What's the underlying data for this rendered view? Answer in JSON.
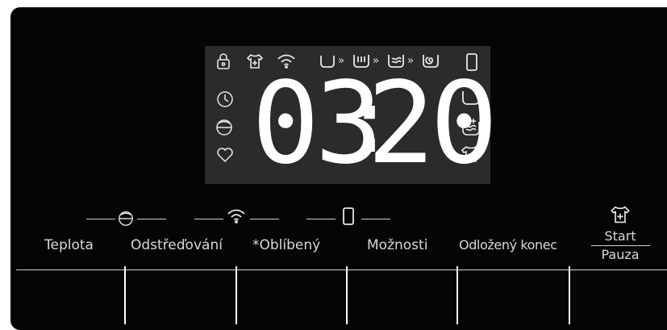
{
  "display": {
    "time_hours": "03",
    "time_minutes": "20",
    "colon": ":",
    "progress_chevron": "»"
  },
  "icons": {
    "top_row": [
      "lock-icon",
      "shirt-plus-icon",
      "wifi-icon",
      "tub-icon",
      "tub-wash-icon",
      "tub-rinse-icon",
      "tub-spin-icon",
      "phone-icon"
    ],
    "left_col": [
      "clock-icon",
      "spin-drum-icon",
      "heart-icon"
    ],
    "right_col": [
      "tub-icon",
      "tub-add-icon",
      "shirt-dry-icon"
    ]
  },
  "buttons": {
    "teplota": "Teplota",
    "odstredovani": "Odstřeďování",
    "oblibeny": "*Oblíbený",
    "moznosti": "Možnosti",
    "odlozeny_konec": "Odložený konec",
    "start": "Start",
    "pauza": "Pauza"
  },
  "colors": {
    "panel": "#050505",
    "lcd_background": "#2b2b2b",
    "lcd_segments": "#ffffff",
    "label_text": "#d7d7d7"
  }
}
